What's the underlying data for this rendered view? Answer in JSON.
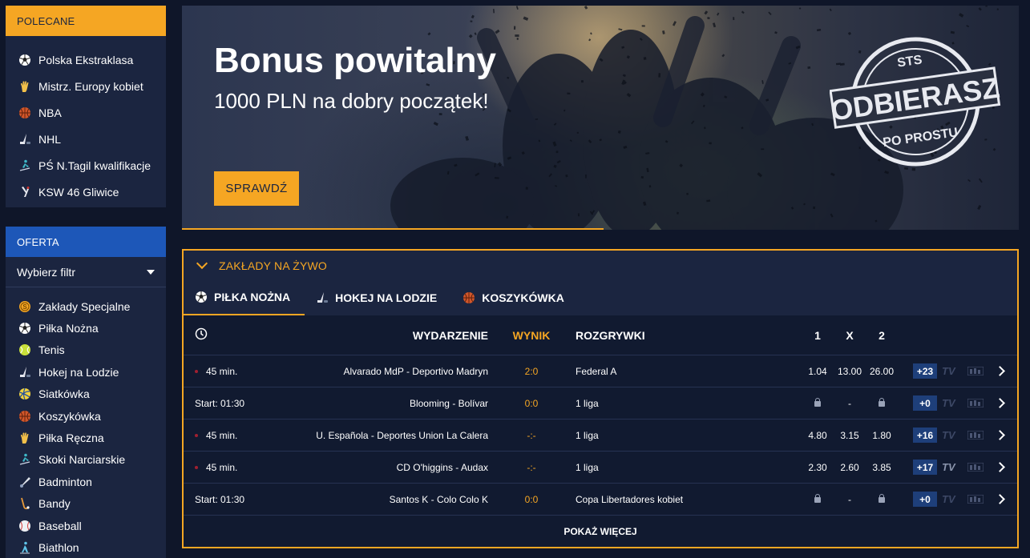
{
  "recommended": {
    "title": "POLECANE",
    "items": [
      {
        "label": "Polska Ekstraklasa",
        "icon": "football-icon"
      },
      {
        "label": "Mistrz. Europy kobiet",
        "icon": "handball-icon"
      },
      {
        "label": "NBA",
        "icon": "basketball-icon"
      },
      {
        "label": "NHL",
        "icon": "hockey-icon"
      },
      {
        "label": "PŚ N.Tagil kwalifikacje",
        "icon": "ski-jump-icon"
      },
      {
        "label": "KSW 46 Gliwice",
        "icon": "mma-icon"
      }
    ]
  },
  "offer": {
    "title": "OFERTA",
    "filter_label": "Wybierz filtr",
    "sports": [
      {
        "label": "Zakłady Specjalne",
        "icon": "special-bets-icon"
      },
      {
        "label": "Piłka Nożna",
        "icon": "football-icon"
      },
      {
        "label": "Tenis",
        "icon": "tennis-icon"
      },
      {
        "label": "Hokej na Lodzie",
        "icon": "hockey-icon"
      },
      {
        "label": "Siatkówka",
        "icon": "volleyball-icon"
      },
      {
        "label": "Koszykówka",
        "icon": "basketball-icon"
      },
      {
        "label": "Piłka Ręczna",
        "icon": "handball-icon"
      },
      {
        "label": "Skoki Narciarskie",
        "icon": "ski-jump-icon"
      },
      {
        "label": "Badminton",
        "icon": "badminton-icon"
      },
      {
        "label": "Bandy",
        "icon": "bandy-icon"
      },
      {
        "label": "Baseball",
        "icon": "baseball-icon"
      },
      {
        "label": "Biathlon",
        "icon": "biathlon-icon"
      }
    ]
  },
  "banner": {
    "title": "Bonus powitalny",
    "subtitle": "1000 PLN na dobry początek!",
    "button": "SPRAWDŹ",
    "stamp_top": "STS",
    "stamp_main": "ODBIERASZ",
    "stamp_bottom": "PO PROSTU"
  },
  "live": {
    "title": "ZAKŁADY NA ŻYWO",
    "tabs": [
      {
        "label": "PIŁKA NOŻNA",
        "icon": "football-icon",
        "active": true
      },
      {
        "label": "HOKEJ NA LODZIE",
        "icon": "hockey-icon",
        "active": false
      },
      {
        "label": "KOSZYKÓWKA",
        "icon": "basketball-icon",
        "active": false
      }
    ],
    "headers": {
      "event": "WYDARZENIE",
      "score": "WYNIK",
      "league": "ROZGRYWKI",
      "h1": "1",
      "hx": "X",
      "h2": "2"
    },
    "rows": [
      {
        "live": true,
        "time": "45 min.",
        "event": "Alvarado MdP - Deportivo Madryn",
        "score": "2:0",
        "league": "Federal A",
        "o1": "1.04",
        "ox": "13.00",
        "o2": "26.00",
        "locked": false,
        "more": "+23",
        "tv": "TV",
        "tv_on": false
      },
      {
        "live": false,
        "time": "Start: 01:30",
        "event": "Blooming - Bolívar",
        "score": "0:0",
        "league": "1 liga",
        "o1": "",
        "ox": "-",
        "o2": "",
        "locked": true,
        "more": "+0",
        "tv": "TV",
        "tv_on": false
      },
      {
        "live": true,
        "time": "45 min.",
        "event": "U. Española - Deportes Union La Calera",
        "score": "-:-",
        "league": "1 liga",
        "o1": "4.80",
        "ox": "3.15",
        "o2": "1.80",
        "locked": false,
        "more": "+16",
        "tv": "TV",
        "tv_on": false
      },
      {
        "live": true,
        "time": "45 min.",
        "event": "CD O'higgins - Audax",
        "score": "-:-",
        "league": "1 liga",
        "o1": "2.30",
        "ox": "2.60",
        "o2": "3.85",
        "locked": false,
        "more": "+17",
        "tv": "TV",
        "tv_on": true
      },
      {
        "live": false,
        "time": "Start: 01:30",
        "event": "Santos K - Colo Colo K",
        "score": "0:0",
        "league": "Copa Libertadores kobiet",
        "o1": "",
        "ox": "-",
        "o2": "",
        "locked": true,
        "more": "+0",
        "tv": "TV",
        "tv_on": false
      }
    ],
    "show_more": "POKAŻ WIĘCEJ"
  },
  "colors": {
    "accent": "#f5a623",
    "panel": "#1b2540",
    "offer_head": "#1d57b8",
    "page_bg": "#0f1629"
  }
}
